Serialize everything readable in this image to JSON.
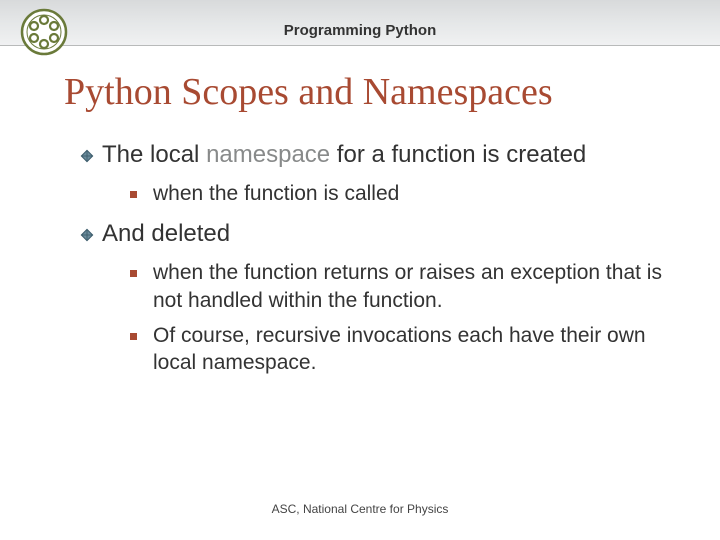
{
  "header": {
    "title": "Programming Python"
  },
  "slide": {
    "title": "Python Scopes and Namespaces"
  },
  "bullets": {
    "item1_prefix": "The local ",
    "item1_grey": "namespace",
    "item1_suffix": " for a function is created",
    "item1_sub1": "when the function is called",
    "item2": "And deleted",
    "item2_sub1": "when the function returns or raises an exception that is not handled within the function.",
    "item2_sub2": "Of course, recursive invocations each have their own local namespace."
  },
  "footer": {
    "text": "ASC, National Centre for Physics"
  }
}
